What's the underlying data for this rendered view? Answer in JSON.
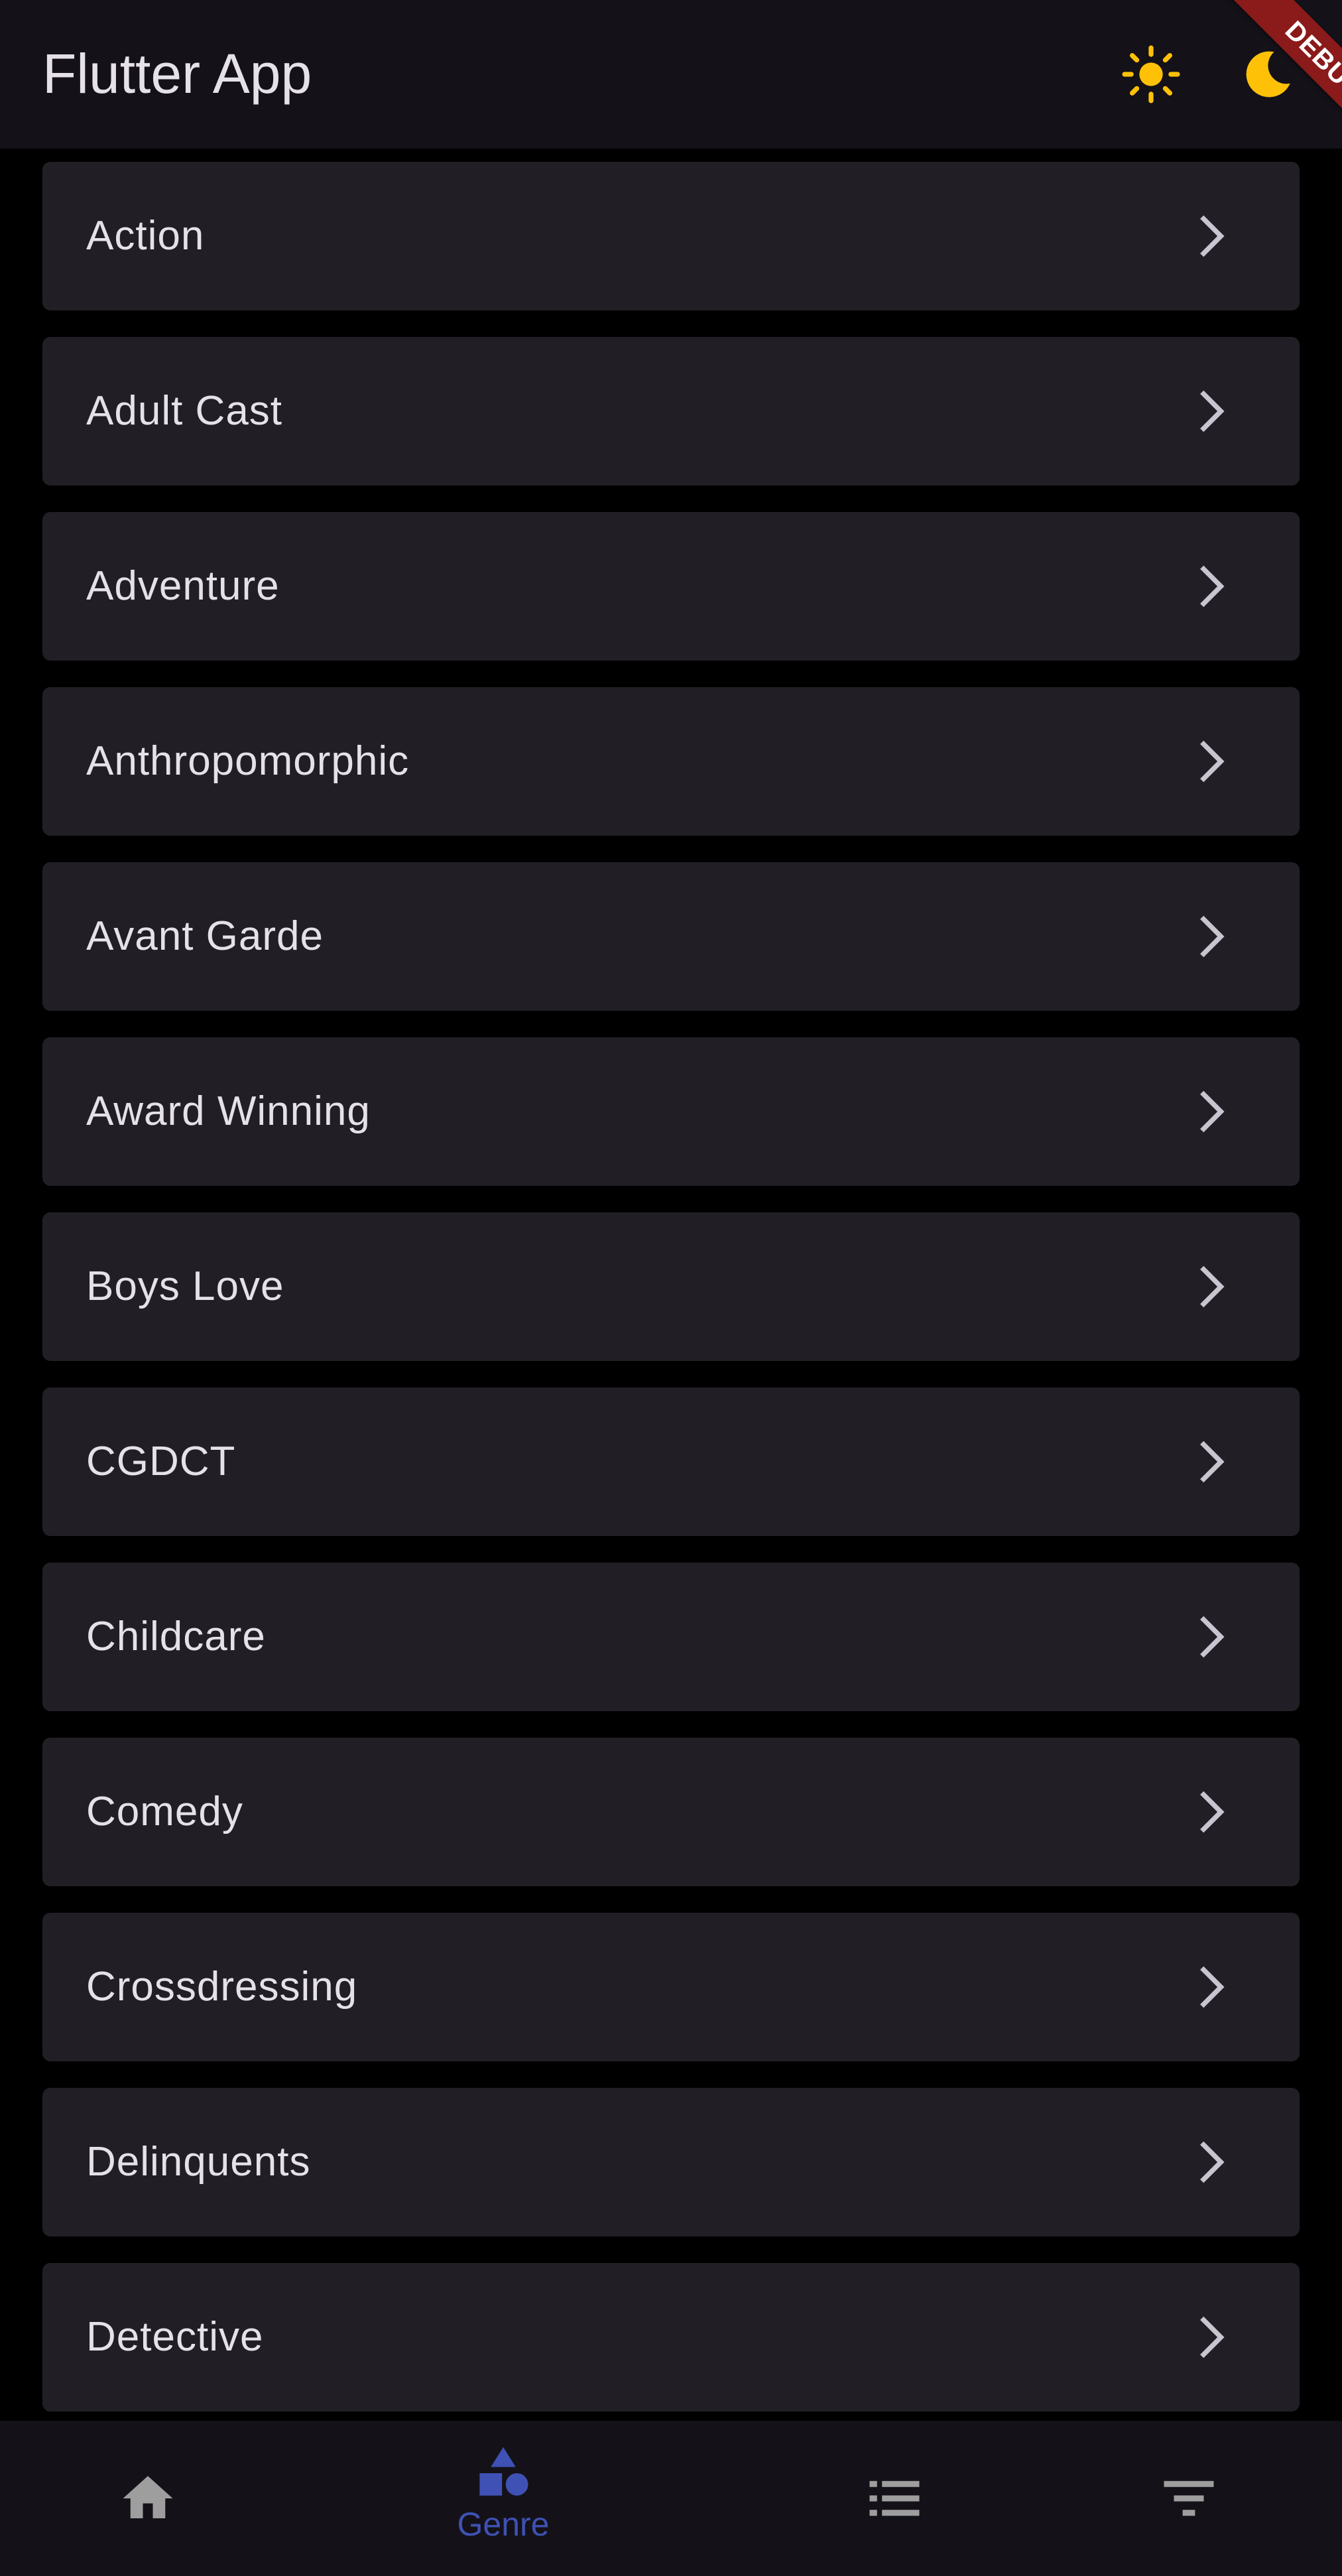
{
  "app_bar": {
    "title": "Flutter App",
    "icons": [
      "sun-icon",
      "moon-icon"
    ],
    "debug_banner": "DEBUG"
  },
  "genres": [
    {
      "label": "Action"
    },
    {
      "label": "Adult Cast"
    },
    {
      "label": "Adventure"
    },
    {
      "label": "Anthropomorphic"
    },
    {
      "label": "Avant Garde"
    },
    {
      "label": "Award Winning"
    },
    {
      "label": "Boys Love"
    },
    {
      "label": "CGDCT"
    },
    {
      "label": "Childcare"
    },
    {
      "label": "Comedy"
    },
    {
      "label": "Crossdressing"
    },
    {
      "label": "Delinquents"
    },
    {
      "label": "Detective"
    }
  ],
  "bottom_nav": {
    "items": [
      {
        "icon": "home-icon",
        "label": ""
      },
      {
        "icon": "shapes-icon",
        "label": "Genre",
        "selected": true
      },
      {
        "icon": "list-icon",
        "label": ""
      },
      {
        "icon": "filter-icon",
        "label": ""
      }
    ]
  },
  "colors": {
    "background": "#000000",
    "app_bar": "#141218",
    "card": "#211f25",
    "text": "#e6e1e8",
    "chevron": "#cac4d0",
    "sun": "#ffc107",
    "nav_selected": "#3f51b5",
    "nav_unselected": "#9e9e9e",
    "debug": "#8b1a1a"
  }
}
